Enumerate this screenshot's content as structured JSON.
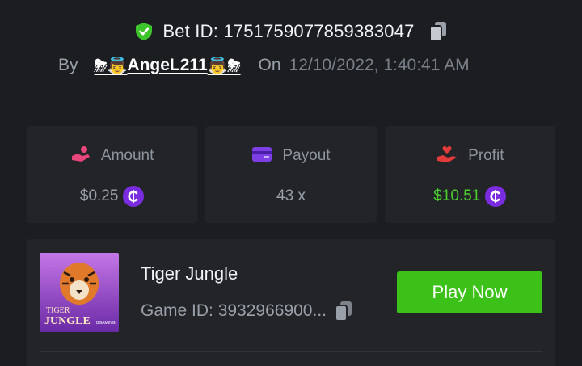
{
  "bet": {
    "id_text": "Bet ID: 1751759077859383047",
    "by_label": "By",
    "user_name": "AngeL211",
    "user_prefix_emoji": "⛈👼",
    "user_suffix_emoji": "👼⛈",
    "on_label": "On",
    "date": "12/10/2022, 1:40:41 AM"
  },
  "stats": [
    {
      "label": "Amount",
      "value": "$0.25",
      "icon": "hand-coins-icon",
      "icon_color": "#e8457a",
      "value_color": "#9aa0aa"
    },
    {
      "label": "Payout",
      "value": "43 x",
      "icon": "card-icon",
      "icon_color": "#7b3fe4",
      "value_color": "#9aa0aa"
    },
    {
      "label": "Profit",
      "value": "$10.51",
      "icon": "hand-heart-icon",
      "icon_color": "#e33b3b",
      "value_color": "#4ccf2e"
    }
  ],
  "game": {
    "title": "Tiger Jungle",
    "id_text": "Game ID: 3932966900...",
    "play_label": "Play Now",
    "thumb_text_1": "TIGER",
    "thumb_text_2": "JUNGLE",
    "thumb_text_3": "BGAMING"
  },
  "colors": {
    "background": "#1b1d21",
    "card": "#222428",
    "accent_green": "#3bc117",
    "coin_purple": "#7a2ce0"
  }
}
